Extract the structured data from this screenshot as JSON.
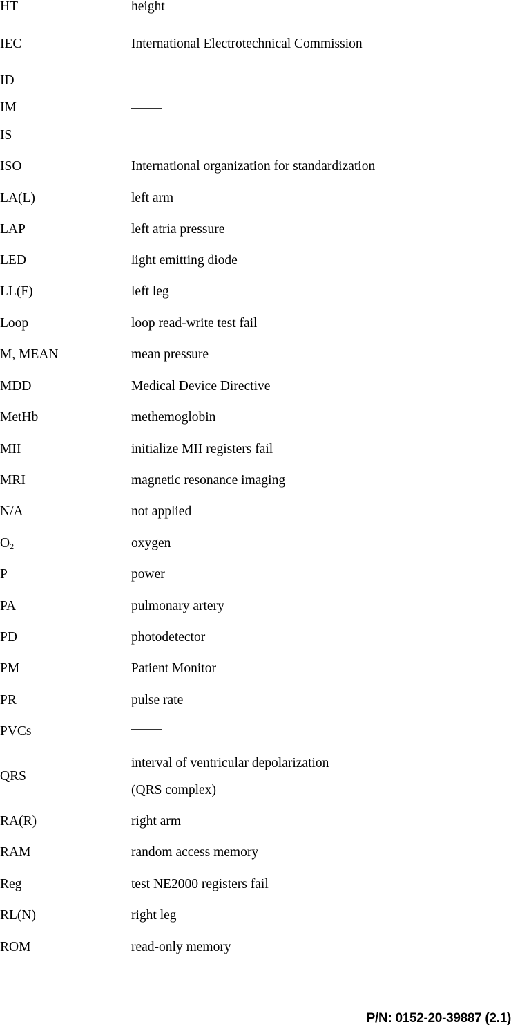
{
  "glossary": [
    {
      "abbr": "HT",
      "definition": "height"
    },
    {
      "abbr": "IEC",
      "definition": "International Electrotechnical Commission"
    },
    {
      "abbr": "ID",
      "definition": ""
    },
    {
      "abbr": "IM",
      "definition": "——"
    },
    {
      "abbr": "IS",
      "definition": ""
    },
    {
      "abbr": "ISO",
      "definition": "International organization for standardization"
    },
    {
      "abbr": "LA(L)",
      "definition": "left arm"
    },
    {
      "abbr": "LAP",
      "definition": "left atria pressure"
    },
    {
      "abbr": "LED",
      "definition": "light emitting diode"
    },
    {
      "abbr": "LL(F)",
      "definition": "left leg"
    },
    {
      "abbr": "Loop",
      "definition": "loop read-write test fail"
    },
    {
      "abbr": "M, MEAN",
      "definition": "mean pressure"
    },
    {
      "abbr": "MDD",
      "definition": "Medical Device Directive"
    },
    {
      "abbr": "MetHb",
      "definition": "methemoglobin"
    },
    {
      "abbr": "MII",
      "definition": "initialize MII registers fail"
    },
    {
      "abbr": "MRI",
      "definition": "magnetic resonance imaging"
    },
    {
      "abbr": "N/A",
      "definition": "not applied"
    },
    {
      "abbr": "O",
      "abbr_sub": "2",
      "definition": "oxygen"
    },
    {
      "abbr": "P",
      "definition": "power"
    },
    {
      "abbr": "PA",
      "definition": "pulmonary artery"
    },
    {
      "abbr": "PD",
      "definition": "photodetector"
    },
    {
      "abbr": "PM",
      "definition": "Patient Monitor"
    },
    {
      "abbr": "PR",
      "definition": "pulse rate"
    },
    {
      "abbr": "PVCs",
      "definition": "——"
    },
    {
      "abbr": "QRS",
      "definition": "interval of ventricular depolarization",
      "definition_line2": "(QRS complex)"
    },
    {
      "abbr": "RA(R)",
      "definition": "right arm"
    },
    {
      "abbr": "RAM",
      "definition": "random access memory"
    },
    {
      "abbr": "Reg",
      "definition": "test NE2000 registers fail"
    },
    {
      "abbr": "RL(N)",
      "definition": "right leg"
    },
    {
      "abbr": "ROM",
      "definition": "read-only memory"
    }
  ],
  "footer": {
    "part_number": "P/N: 0152-20-39887 (2.1)"
  }
}
